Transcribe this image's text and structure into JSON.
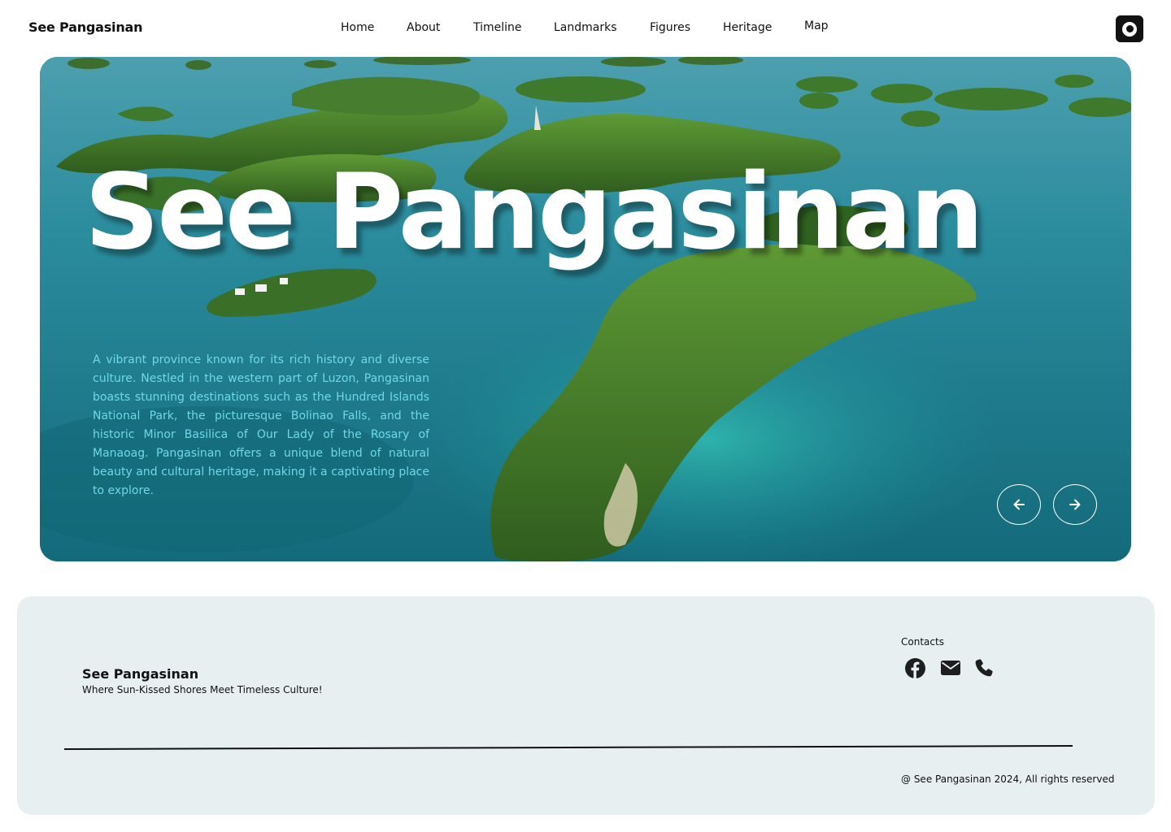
{
  "header": {
    "brand": "See Pangasinan",
    "nav": [
      "Home",
      "About",
      "Timeline",
      "Landmarks",
      "Figures",
      "Heritage",
      "Map"
    ],
    "theme_toggle_icon": "theme-toggle-icon"
  },
  "hero": {
    "title": "See Pangasinan",
    "description": "A vibrant province known for its rich history and diverse culture. Nestled in the western part of Luzon, Pangasinan boasts stunning destinations such as the Hundred Islands National Park, the picturesque Bolinao Falls, and the historic Minor Basilica of Our Lady of the Rosary of Manaoag. Pangasinan offers a unique blend of natural beauty and cultural heritage, making it a captivating place to explore.",
    "prev_icon": "arrow-left-icon",
    "next_icon": "arrow-right-icon"
  },
  "footer": {
    "brand": "See Pangasinan",
    "tagline": "Where Sun-Kissed Shores Meet Timeless Culture!",
    "contacts_label": "Contacts",
    "contact_icons": [
      "facebook-icon",
      "mail-icon",
      "phone-icon"
    ],
    "copyright": "@ See Pangasinan 2024, All rights reserved"
  },
  "colors": {
    "sea": "#1c8a96",
    "island": "#3f7d2a",
    "footer_bg": "#e8eff1",
    "description_text": "#6fd8e6"
  }
}
